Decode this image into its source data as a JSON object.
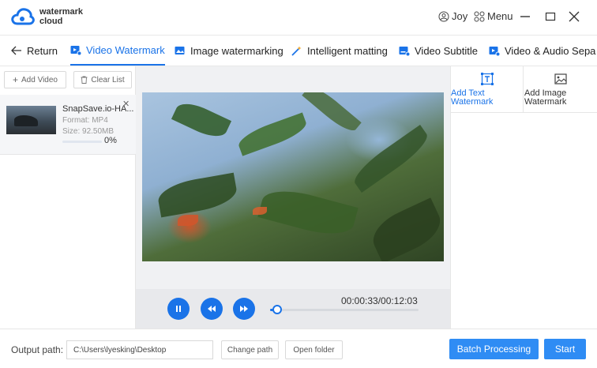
{
  "app": {
    "logo_line1": "watermark",
    "logo_line2": "cloud",
    "brand_color": "#1a73e8"
  },
  "titlebar": {
    "user_name": "Joy",
    "menu_label": "Menu",
    "icons": [
      "user-icon",
      "grid-icon",
      "minimize-icon",
      "maximize-icon",
      "close-icon"
    ]
  },
  "nav": {
    "return_label": "Return",
    "tabs": [
      {
        "label": "Video Watermark",
        "active": true
      },
      {
        "label": "Image watermarking",
        "active": false
      },
      {
        "label": "Intelligent matting",
        "active": false
      },
      {
        "label": "Video Subtitle",
        "active": false
      },
      {
        "label": "Video & Audio Sepa",
        "active": false
      }
    ]
  },
  "left_panel": {
    "add_video_label": "Add Video",
    "clear_list_label": "Clear List",
    "file": {
      "name": "SnapSave.io-HA...",
      "format": "Format:  MP4",
      "size": "Size:  92.50MB",
      "progress_text": "0%",
      "progress": 0
    }
  },
  "player": {
    "time_display": "00:00:33/00:12:03",
    "position_fraction": 0.046
  },
  "right_panel": {
    "tools": [
      {
        "line1": "Add Text",
        "line2": "Watermark"
      },
      {
        "line1": "Add Image",
        "line2": "Watermark"
      }
    ]
  },
  "footer": {
    "output_label": "Output path:",
    "output_path": "C:\\Users\\lyesking\\Desktop",
    "change_path_label": "Change path",
    "open_folder_label": "Open folder",
    "batch_label": "Batch Processing",
    "start_label": "Start"
  }
}
